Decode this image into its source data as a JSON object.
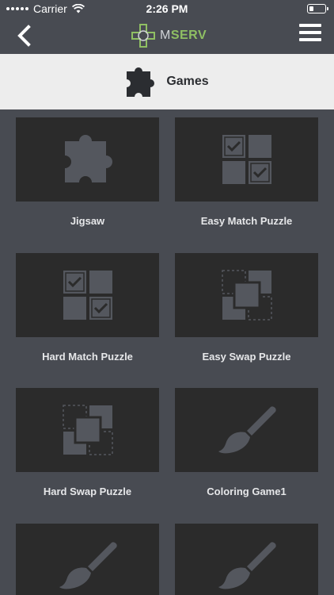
{
  "status_bar": {
    "carrier": "Carrier",
    "time": "2:26 PM"
  },
  "nav": {
    "logo_prefix": "M",
    "logo_suffix": "SERV",
    "logo_accent_color": "#8fbf63"
  },
  "section": {
    "title": "Games",
    "icon": "puzzle-icon"
  },
  "games": [
    {
      "label": "Jigsaw",
      "icon": "jigsaw-puzzle-icon"
    },
    {
      "label": "Easy Match Puzzle",
      "icon": "match-puzzle-icon"
    },
    {
      "label": "Hard Match Puzzle",
      "icon": "match-puzzle-icon"
    },
    {
      "label": "Easy Swap Puzzle",
      "icon": "swap-puzzle-icon"
    },
    {
      "label": "Hard Swap Puzzle",
      "icon": "swap-puzzle-icon"
    },
    {
      "label": "Coloring Game1",
      "icon": "paint-brush-icon"
    },
    {
      "label": "",
      "icon": "paint-brush-icon"
    },
    {
      "label": "",
      "icon": "paint-brush-icon"
    }
  ],
  "colors": {
    "background": "#484b52",
    "tile": "#2b2b2b",
    "icon_gray": "#54575e",
    "header_bg": "#ededed"
  }
}
